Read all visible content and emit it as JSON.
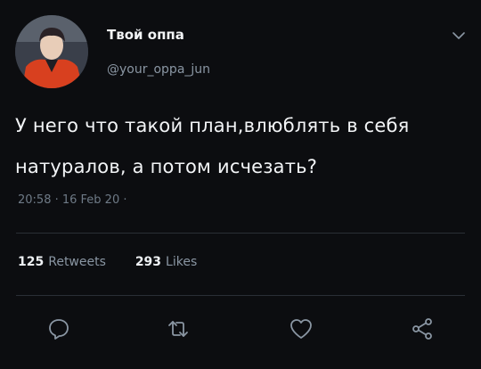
{
  "author": {
    "display_name": "Твой оппа",
    "handle": "@your_oppa_jun"
  },
  "tweet": {
    "text": "У него что такой план,влюблять в себя натуралов, а потом исчезать?",
    "timestamp": "20:58 · 16 Feb 20 ·"
  },
  "stats": {
    "retweets_count": "125",
    "retweets_label": "Retweets",
    "likes_count": "293",
    "likes_label": "Likes"
  },
  "icons": {
    "more": "chevron-down-icon",
    "reply": "reply-icon",
    "retweet": "retweet-icon",
    "like": "heart-icon",
    "share": "share-icon"
  },
  "colors": {
    "background": "#0c0d10",
    "text": "#f2f4f6",
    "muted": "#8a96a3",
    "icon": "#8a96a3"
  }
}
